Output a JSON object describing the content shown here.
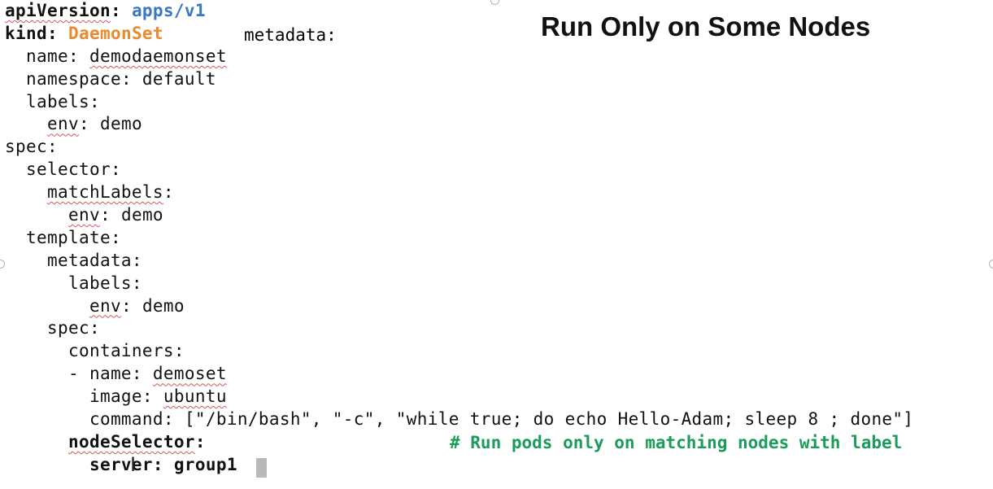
{
  "title": "Run Only on Some Nodes",
  "code": {
    "apiVersion_key": "apiVersion",
    "apiVersion_value": "apps/v1",
    "kind_key": "kind",
    "kind_value": "DaemonSet",
    "inline_metadata": "metadata:",
    "name_line_key": "name",
    "name_line_value": "demodaemonset",
    "namespace_line": "namespace: default",
    "labels_line": "labels:",
    "env_key": "env",
    "env_value": "demo",
    "spec_line": "spec:",
    "selector_line": "selector:",
    "matchLabels_key": "matchLabels",
    "template_line": "template:",
    "metadata_line": "metadata:",
    "spec_inner_line": "spec:",
    "containers_line": "containers:",
    "container_name_prefix": "- name: ",
    "container_name_value": "demoset",
    "image_key": "image: ",
    "image_value": "ubuntu",
    "command_line": "command: [\"/bin/bash\", \"-c\", \"while true; do echo Hello-Adam; sleep 8 ; done\"]",
    "nodeSelector_key": "nodeSelector",
    "server_key": "server",
    "server_value": "group1"
  },
  "comment": "# Run pods only on matching nodes with label",
  "colors": {
    "key_blue": "#3a77c0",
    "kind_orange": "#e98a2e",
    "comment_green": "#1a9c5a",
    "spell_squiggle": "#d8545a"
  },
  "icons": [
    "text-cursor-ibeam-icon"
  ]
}
